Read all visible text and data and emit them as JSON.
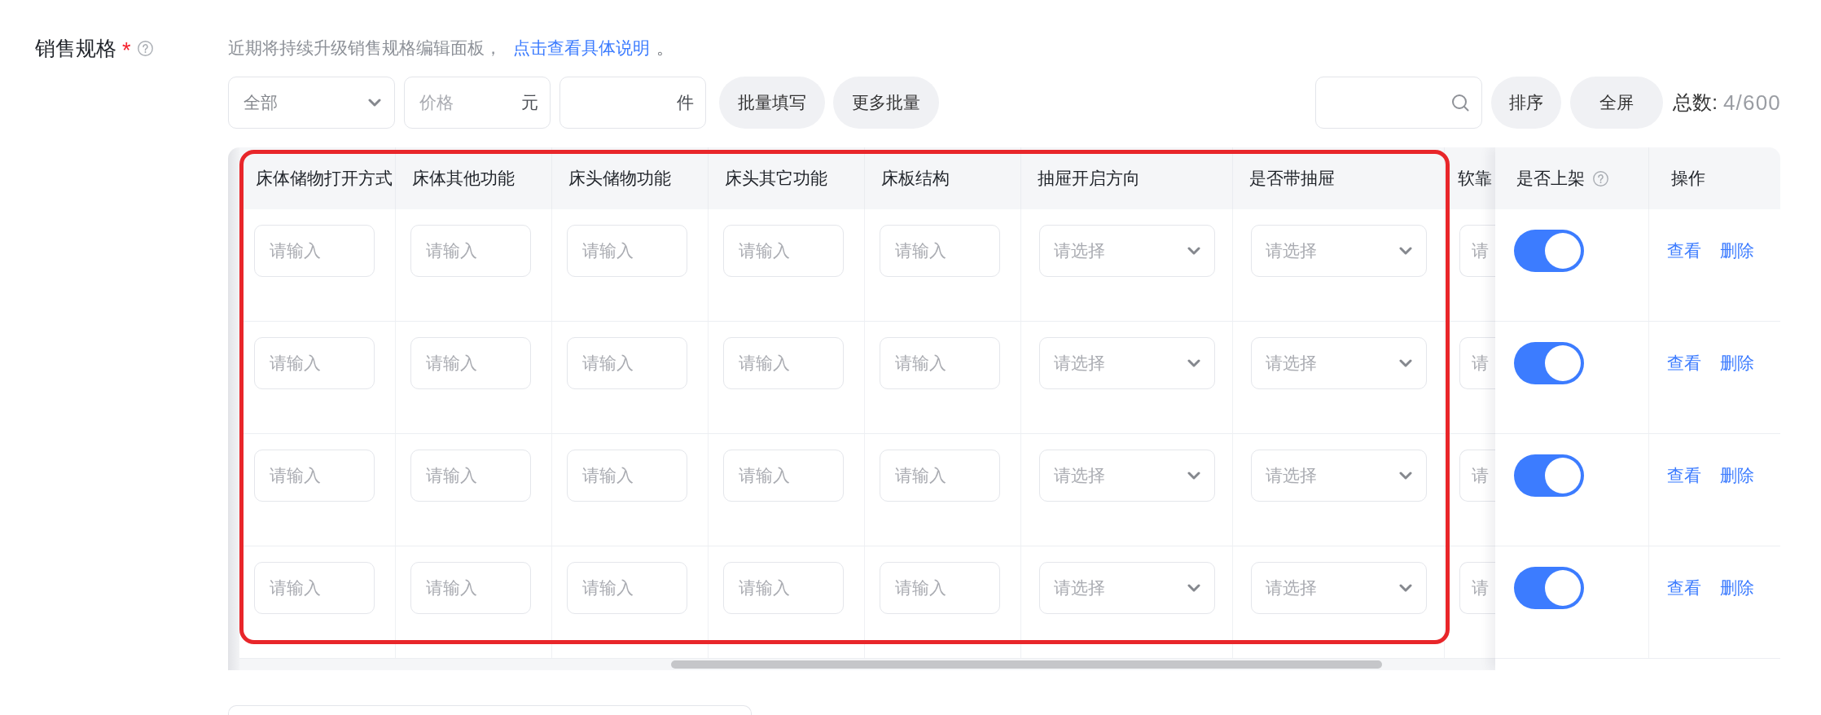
{
  "field": {
    "label": "销售规格",
    "required_mark": "*",
    "help": true,
    "hint": {
      "text": "近期将持续升级销售规格编辑面板，",
      "link": "点击查看具体说明",
      "end": "。"
    }
  },
  "toolbar": {
    "filter_select": {
      "value": "全部"
    },
    "price_field": {
      "placeholder": "价格",
      "unit": "元"
    },
    "quantity_field": {
      "unit": "件"
    },
    "batch_buttons": [
      "批量填写",
      "更多批量"
    ],
    "view_buttons": [
      "排序",
      "全屏"
    ],
    "total": {
      "label": "总数:",
      "value": "4/600"
    }
  },
  "table": {
    "highlight_frame": true,
    "columns": [
      {
        "header": "床体储物打开方式",
        "kind": "input"
      },
      {
        "header": "床体其他功能",
        "kind": "input"
      },
      {
        "header": "床头储物功能",
        "kind": "input"
      },
      {
        "header": "床头其它功能",
        "kind": "input"
      },
      {
        "header": "床板结构",
        "kind": "input"
      },
      {
        "header": "抽屉开启方向",
        "kind": "select"
      },
      {
        "header": "是否带抽屉",
        "kind": "select"
      },
      {
        "header": "软靠",
        "kind": "input"
      }
    ],
    "fixed_columns": [
      {
        "header": "是否上架",
        "kind": "switch",
        "help": true
      },
      {
        "header": "操作",
        "kind": "actions",
        "help": false
      }
    ],
    "rows": [
      {
        "cells": [
          {
            "placeholder": "请输入"
          },
          {
            "placeholder": "请输入"
          },
          {
            "placeholder": "请输入"
          },
          {
            "placeholder": "请输入"
          },
          {
            "placeholder": "请输入"
          },
          {
            "placeholder": "请选择"
          },
          {
            "placeholder": "请选择"
          },
          {
            "placeholder": "请"
          }
        ],
        "on": true,
        "actions": [
          "查看",
          "删除"
        ]
      },
      {
        "cells": [
          {
            "placeholder": "请输入"
          },
          {
            "placeholder": "请输入"
          },
          {
            "placeholder": "请输入"
          },
          {
            "placeholder": "请输入"
          },
          {
            "placeholder": "请输入"
          },
          {
            "placeholder": "请选择"
          },
          {
            "placeholder": "请选择"
          },
          {
            "placeholder": "请"
          }
        ],
        "on": true,
        "actions": [
          "查看",
          "删除"
        ]
      },
      {
        "cells": [
          {
            "placeholder": "请输入"
          },
          {
            "placeholder": "请输入"
          },
          {
            "placeholder": "请输入"
          },
          {
            "placeholder": "请输入"
          },
          {
            "placeholder": "请输入"
          },
          {
            "placeholder": "请选择"
          },
          {
            "placeholder": "请选择"
          },
          {
            "placeholder": "请"
          }
        ],
        "on": true,
        "actions": [
          "查看",
          "删除"
        ]
      },
      {
        "cells": [
          {
            "placeholder": "请输入"
          },
          {
            "placeholder": "请输入"
          },
          {
            "placeholder": "请输入"
          },
          {
            "placeholder": "请输入"
          },
          {
            "placeholder": "请输入"
          },
          {
            "placeholder": "请选择"
          },
          {
            "placeholder": "请选择"
          },
          {
            "placeholder": "请"
          }
        ],
        "on": true,
        "actions": [
          "查看",
          "删除"
        ]
      }
    ]
  }
}
